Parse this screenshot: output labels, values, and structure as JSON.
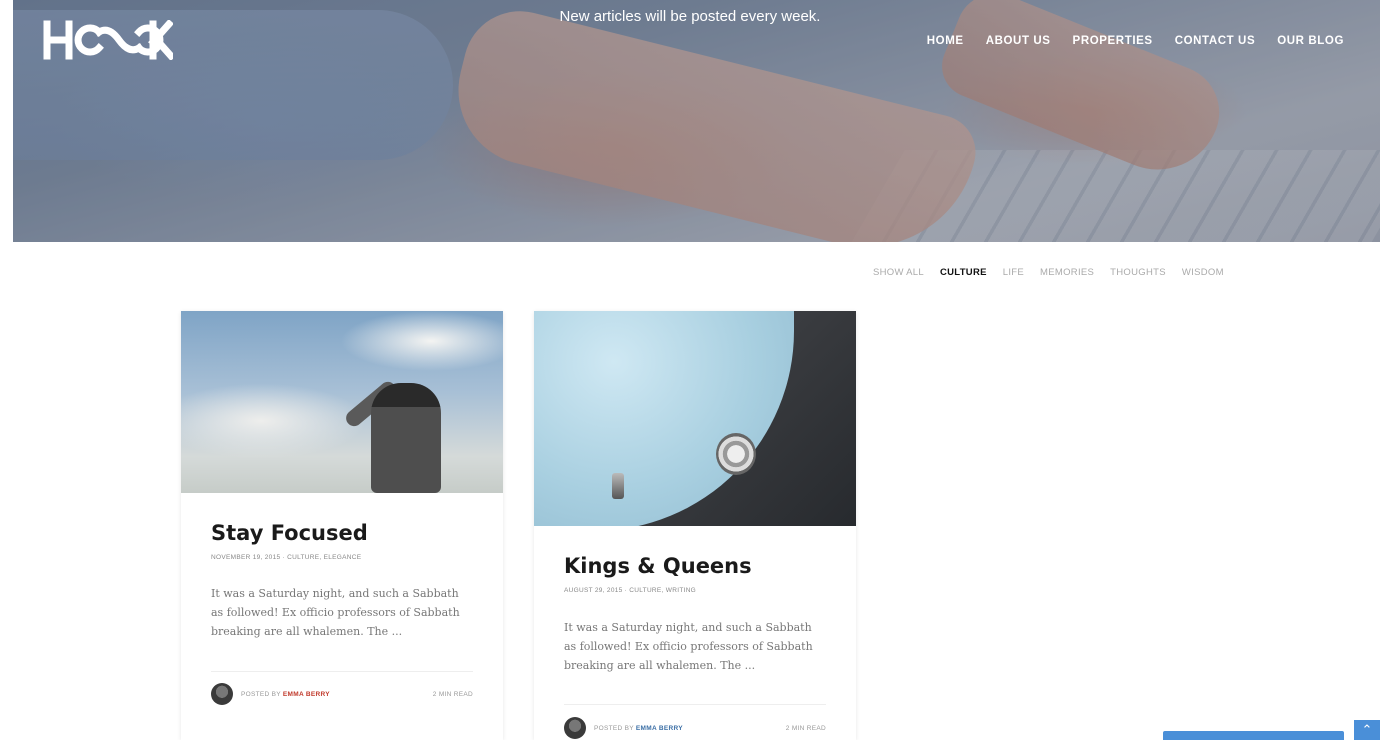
{
  "hero": {
    "logo": "HOOK",
    "tagline": "New articles will be posted every week."
  },
  "nav": {
    "items": [
      "HOME",
      "ABOUT US",
      "PROPERTIES",
      "CONTACT US",
      "OUR BLOG"
    ]
  },
  "filters": {
    "items": [
      "SHOW ALL",
      "CULTURE",
      "LIFE",
      "MEMORIES",
      "THOUGHTS",
      "WISDOM"
    ],
    "active": "CULTURE"
  },
  "posts": [
    {
      "title": "Stay Focused",
      "meta": "NOVEMBER 19, 2015 · CULTURE, ELEGANCE",
      "excerpt": "It was a Saturday night, and such a Sabbath as followed! Ex officio professors of Sabbath breaking are all whalemen. The ...",
      "posted_by_label": "POSTED BY",
      "author": "EMMA BERRY",
      "read_time": "2 MIN READ"
    },
    {
      "title": "Kings & Queens",
      "meta": "AUGUST 29, 2015 · CULTURE, WRITING",
      "excerpt": "It was a Saturday night, and such a Sabbath as followed! Ex officio professors of Sabbath breaking are all whalemen. The ...",
      "posted_by_label": "POSTED BY",
      "author": "EMMA BERRY",
      "read_time": "2 MIN READ"
    }
  ],
  "widgets": {
    "scroll_top_icon": "chevron-up-icon"
  },
  "colors": {
    "accent_author": "#c0392b",
    "widget_blue": "#4a8fd8"
  }
}
